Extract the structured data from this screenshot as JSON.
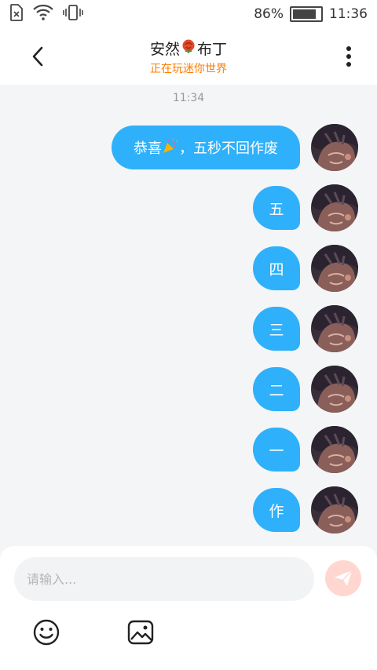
{
  "status_bar": {
    "battery_percent": "86%",
    "battery_level": 0.86,
    "time": "11:36",
    "icons": [
      "sim-card-icon",
      "wifi-icon",
      "vibrate-icon",
      "battery-icon"
    ]
  },
  "header": {
    "title_before": "安然",
    "title_after": "布丁",
    "title_emoji_icon": "rose-icon",
    "subtitle": "正在玩迷你世界",
    "accent_color": "#ff7d00"
  },
  "chat": {
    "timestamp": "11:34",
    "bubble_color": "#2fb0fa",
    "messages": [
      {
        "before": "恭喜",
        "emoji_icon": "party-popper-icon",
        "after": "，五秒不回作废"
      },
      {
        "text": "五"
      },
      {
        "text": "四"
      },
      {
        "text": "三"
      },
      {
        "text": "二"
      },
      {
        "text": "一"
      },
      {
        "text": "作"
      }
    ]
  },
  "composer": {
    "placeholder": "请输入...",
    "value": "",
    "icons": [
      "send-icon",
      "emoji-icon",
      "image-icon"
    ]
  }
}
